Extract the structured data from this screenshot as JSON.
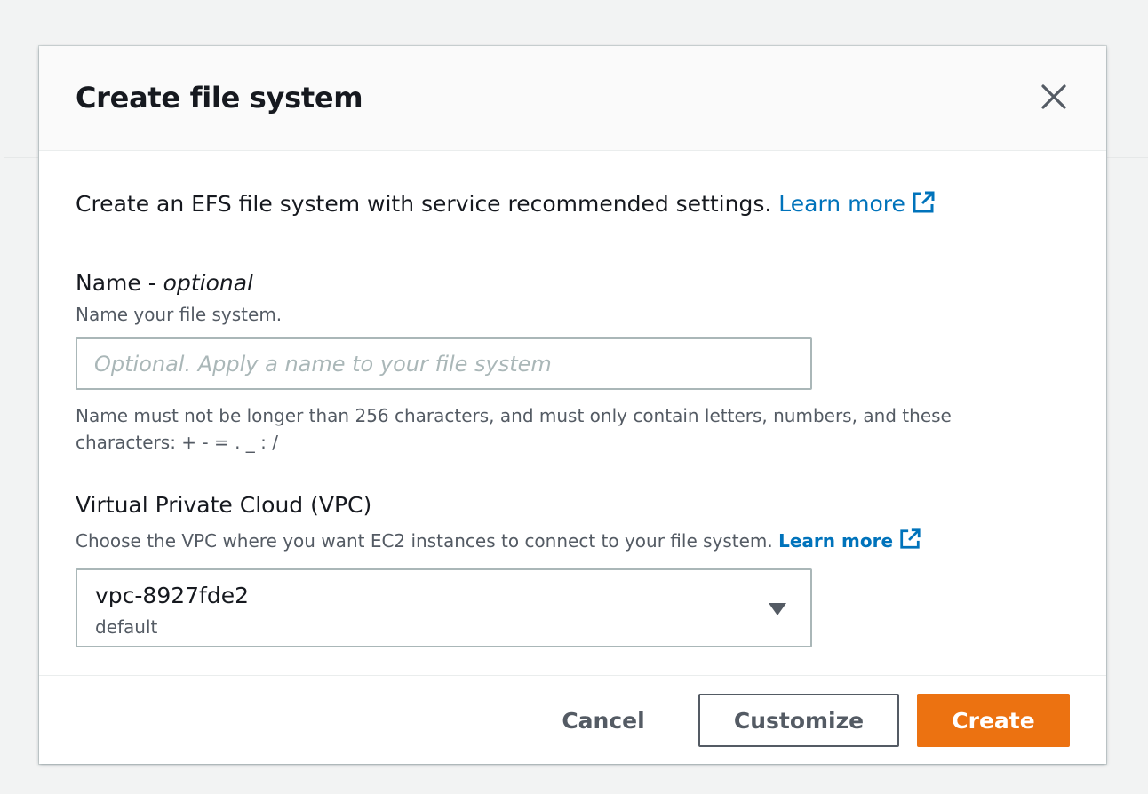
{
  "modal": {
    "title": "Create file system",
    "intro_text": "Create an EFS file system with service recommended settings.",
    "intro_link": "Learn more"
  },
  "name_field": {
    "label": "Name - ",
    "label_optional": "optional",
    "description": "Name your file system.",
    "placeholder": "Optional. Apply a name to your file system",
    "value": "",
    "constraint": "Name must not be longer than 256 characters, and must only contain letters, numbers, and these characters: + - = . _ : /"
  },
  "vpc_field": {
    "label": "Virtual Private Cloud (VPC)",
    "description": "Choose the VPC where you want EC2 instances to connect to your file system.",
    "link": "Learn more",
    "selected_value": "vpc-8927fde2",
    "selected_sub": "default"
  },
  "footer": {
    "cancel_label": "Cancel",
    "customize_label": "Customize",
    "create_label": "Create"
  },
  "colors": {
    "link": "#0073bb",
    "primary_button": "#ec7211",
    "secondary_text": "#545b64",
    "input_border": "#aab7b8"
  },
  "icons": {
    "close": "close-icon",
    "external_link": "external-link-icon",
    "dropdown": "caret-down-icon"
  }
}
